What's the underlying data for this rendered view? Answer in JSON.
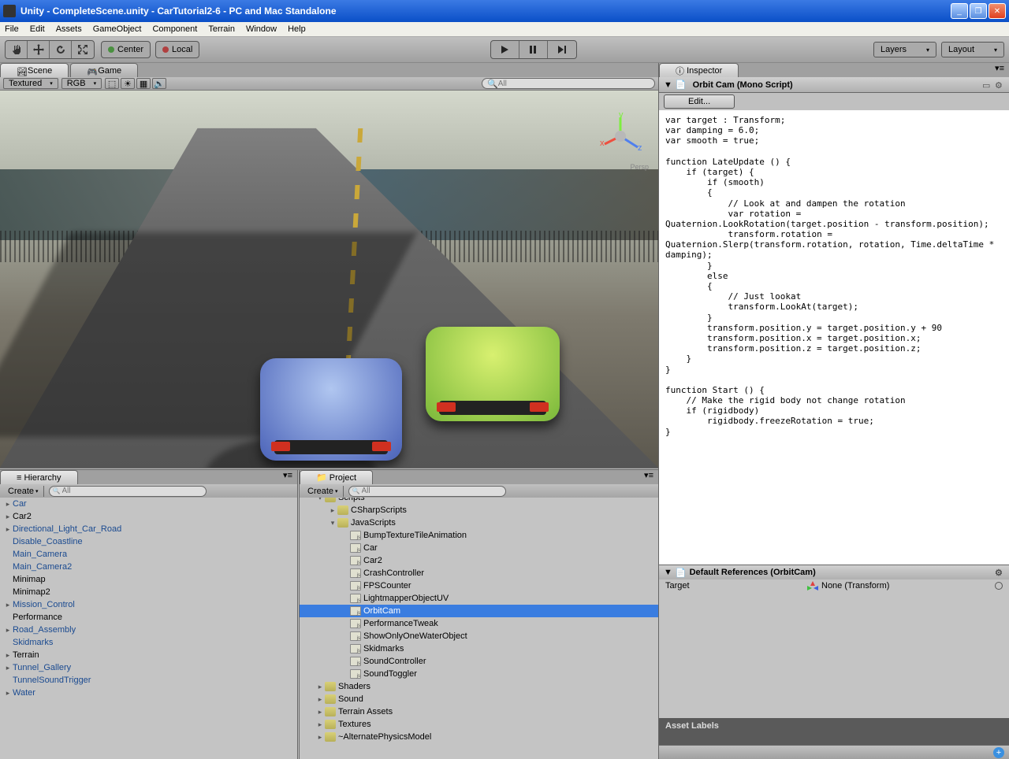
{
  "titlebar": "Unity - CompleteScene.unity - CarTutorial2-6 - PC and Mac Standalone",
  "menu": [
    "File",
    "Edit",
    "Assets",
    "GameObject",
    "Component",
    "Terrain",
    "Window",
    "Help"
  ],
  "toolbar": {
    "center": "Center",
    "local": "Local",
    "layers": "Layers",
    "layout": "Layout"
  },
  "scene": {
    "tab_scene": "Scene",
    "tab_game": "Game",
    "textured": "Textured",
    "rgb": "RGB",
    "search_placeholder": "All",
    "persp": "Persp"
  },
  "hierarchy": {
    "title": "Hierarchy",
    "create": "Create",
    "search_placeholder": "All",
    "items": [
      {
        "label": "Car",
        "expand": true,
        "blue": true
      },
      {
        "label": "Car2",
        "expand": true,
        "blue": false
      },
      {
        "label": "Directional_Light_Car_Road",
        "expand": true,
        "blue": true
      },
      {
        "label": "Disable_Coastline",
        "blue": true
      },
      {
        "label": "Main_Camera",
        "blue": true
      },
      {
        "label": "Main_Camera2",
        "blue": true
      },
      {
        "label": "Minimap",
        "blue": false
      },
      {
        "label": "Minimap2",
        "blue": false
      },
      {
        "label": "Mission_Control",
        "expand": true,
        "blue": true
      },
      {
        "label": "Performance",
        "blue": false
      },
      {
        "label": "Road_Assembly",
        "expand": true,
        "blue": true
      },
      {
        "label": "Skidmarks",
        "blue": true
      },
      {
        "label": "Terrain",
        "expand": true,
        "blue": false
      },
      {
        "label": "Tunnel_Gallery",
        "expand": true,
        "blue": true
      },
      {
        "label": "TunnelSoundTrigger",
        "blue": true
      },
      {
        "label": "Water",
        "expand": true,
        "blue": true
      }
    ]
  },
  "project": {
    "title": "Project",
    "create": "Create",
    "search_placeholder": "All",
    "items": [
      {
        "label": "Scripts",
        "icon": "folder",
        "indent": 1,
        "expand": "down",
        "cut": true
      },
      {
        "label": "CSharpScripts",
        "icon": "folder",
        "indent": 2,
        "expand": "right"
      },
      {
        "label": "JavaScripts",
        "icon": "folder",
        "indent": 2,
        "expand": "down"
      },
      {
        "label": "BumpTextureTileAnimation",
        "icon": "script",
        "indent": 3
      },
      {
        "label": "Car",
        "icon": "script",
        "indent": 3
      },
      {
        "label": "Car2",
        "icon": "script",
        "indent": 3
      },
      {
        "label": "CrashController",
        "icon": "script",
        "indent": 3
      },
      {
        "label": "FPSCounter",
        "icon": "script",
        "indent": 3
      },
      {
        "label": "LightmapperObjectUV",
        "icon": "script",
        "indent": 3
      },
      {
        "label": "OrbitCam",
        "icon": "script",
        "indent": 3,
        "selected": true
      },
      {
        "label": "PerformanceTweak",
        "icon": "script",
        "indent": 3
      },
      {
        "label": "ShowOnlyOneWaterObject",
        "icon": "script",
        "indent": 3
      },
      {
        "label": "Skidmarks",
        "icon": "script",
        "indent": 3
      },
      {
        "label": "SoundController",
        "icon": "script",
        "indent": 3
      },
      {
        "label": "SoundToggler",
        "icon": "script",
        "indent": 3
      },
      {
        "label": "Shaders",
        "icon": "folder",
        "indent": 1,
        "expand": "right"
      },
      {
        "label": "Sound",
        "icon": "folder",
        "indent": 1,
        "expand": "right"
      },
      {
        "label": "Terrain Assets",
        "icon": "folder",
        "indent": 1,
        "expand": "right"
      },
      {
        "label": "Textures",
        "icon": "folder",
        "indent": 1,
        "expand": "right"
      },
      {
        "label": "~AlternatePhysicsModel",
        "icon": "folder",
        "indent": 1,
        "expand": "right"
      }
    ]
  },
  "inspector": {
    "title": "Inspector",
    "script_name": "Orbit Cam (Mono Script)",
    "edit": "Edit...",
    "code": "var target : Transform;\nvar damping = 6.0;\nvar smooth = true;\n\nfunction LateUpdate () {\n    if (target) {\n        if (smooth)\n        {\n            // Look at and dampen the rotation\n            var rotation = Quaternion.LookRotation(target.position - transform.position);\n            transform.rotation = Quaternion.Slerp(transform.rotation, rotation, Time.deltaTime * damping);\n        }\n        else\n        {\n            // Just lookat\n            transform.LookAt(target);\n        }\n        transform.position.y = target.position.y + 90\n        transform.position.x = target.position.x;\n        transform.position.z = target.position.z;\n    }\n}\n\nfunction Start () {\n    // Make the rigid body not change rotation\n    if (rigidbody)\n        rigidbody.freezeRotation = true;\n}",
    "default_refs_title": "Default References (OrbitCam)",
    "target_label": "Target",
    "target_value": "None (Transform)",
    "asset_labels": "Asset Labels"
  }
}
